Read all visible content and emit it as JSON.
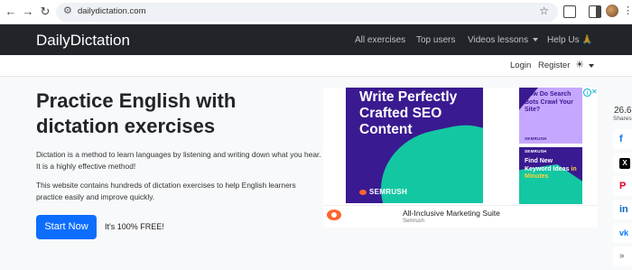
{
  "browser": {
    "url": "dailydictation.com",
    "nav_back": "←",
    "nav_forward": "→",
    "reload": "↻",
    "tune_icon": "⚙",
    "star_icon": "☆",
    "kebab": "⋮"
  },
  "navbar": {
    "brand": "DailyDictation",
    "links": [
      {
        "label": "All exercises"
      },
      {
        "label": "Top users"
      },
      {
        "label": "Videos lessons"
      },
      {
        "label": "Help Us 🙏"
      }
    ]
  },
  "subbar": {
    "login": "Login",
    "register": "Register",
    "theme_icon": "☀"
  },
  "hero": {
    "title": "Practice English with dictation exercises",
    "paragraph1": "Dictation is a method to learn languages by listening and writing down what you hear. It is a highly effective method!",
    "paragraph2": "This website contains hundreds of dictation exercises to help English learners practice easily and improve quickly.",
    "cta_label": "Start Now",
    "cta_note": "It's 100% FREE!"
  },
  "ad": {
    "headline": "Write Perfectly Crafted SEO Content",
    "brand": "SEMRUSH",
    "side1_text": "How Do Search Bots Crawl Your Site?",
    "side2_text_a": "Find New Keyword Ideas",
    "side2_text_b": "in Minutes",
    "choices_icon": "i",
    "close_icon": "✕",
    "bottom_title": "All-Inclusive Marketing Suite",
    "bottom_advertiser": "Semrush"
  },
  "share": {
    "count": "26.6",
    "label": "Shares",
    "facebook": "f",
    "x": "X",
    "pinterest": "P",
    "linkedin": "in",
    "vk": "vk",
    "more": "»"
  },
  "colors": {
    "navbar_bg": "#212529",
    "primary": "#0d6efd",
    "ad_purple": "#3a1a90",
    "ad_teal": "#14c7a3",
    "semrush_orange": "#ff642d"
  }
}
